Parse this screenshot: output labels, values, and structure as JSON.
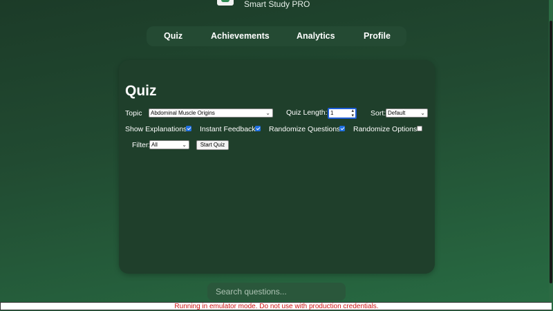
{
  "app": {
    "name": "Smart Study PRO",
    "logo_icon": "app-logo-icon"
  },
  "nav": {
    "items": [
      {
        "label": "Quiz"
      },
      {
        "label": "Achievements"
      },
      {
        "label": "Analytics"
      },
      {
        "label": "Profile"
      }
    ]
  },
  "quiz_panel": {
    "title": "Quiz",
    "topic": {
      "label": "Topic",
      "selected": "Abdominal Muscle Origins"
    },
    "length": {
      "label": "Quiz Length:",
      "value": "1"
    },
    "sort": {
      "label": "Sort:",
      "selected": "Default"
    },
    "options": [
      {
        "label": "Show Explanations",
        "checked": true
      },
      {
        "label": "Instant Feedback",
        "checked": true
      },
      {
        "label": "Randomize Questions",
        "checked": true
      },
      {
        "label": "Randomize Options",
        "checked": false
      }
    ],
    "filter": {
      "label": "Filter:",
      "selected": "All"
    },
    "start_button": "Start Quiz"
  },
  "search": {
    "placeholder": "Search questions..."
  },
  "emulator_warning": "Running in emulator mode. Do not use with production credentials.",
  "colors": {
    "background_top": "#1c3b28",
    "background_bottom": "#286c43",
    "panel": "#1f3f2b",
    "checkbox_accent": "#1f6fe0",
    "warning_text": "#cc1111"
  }
}
